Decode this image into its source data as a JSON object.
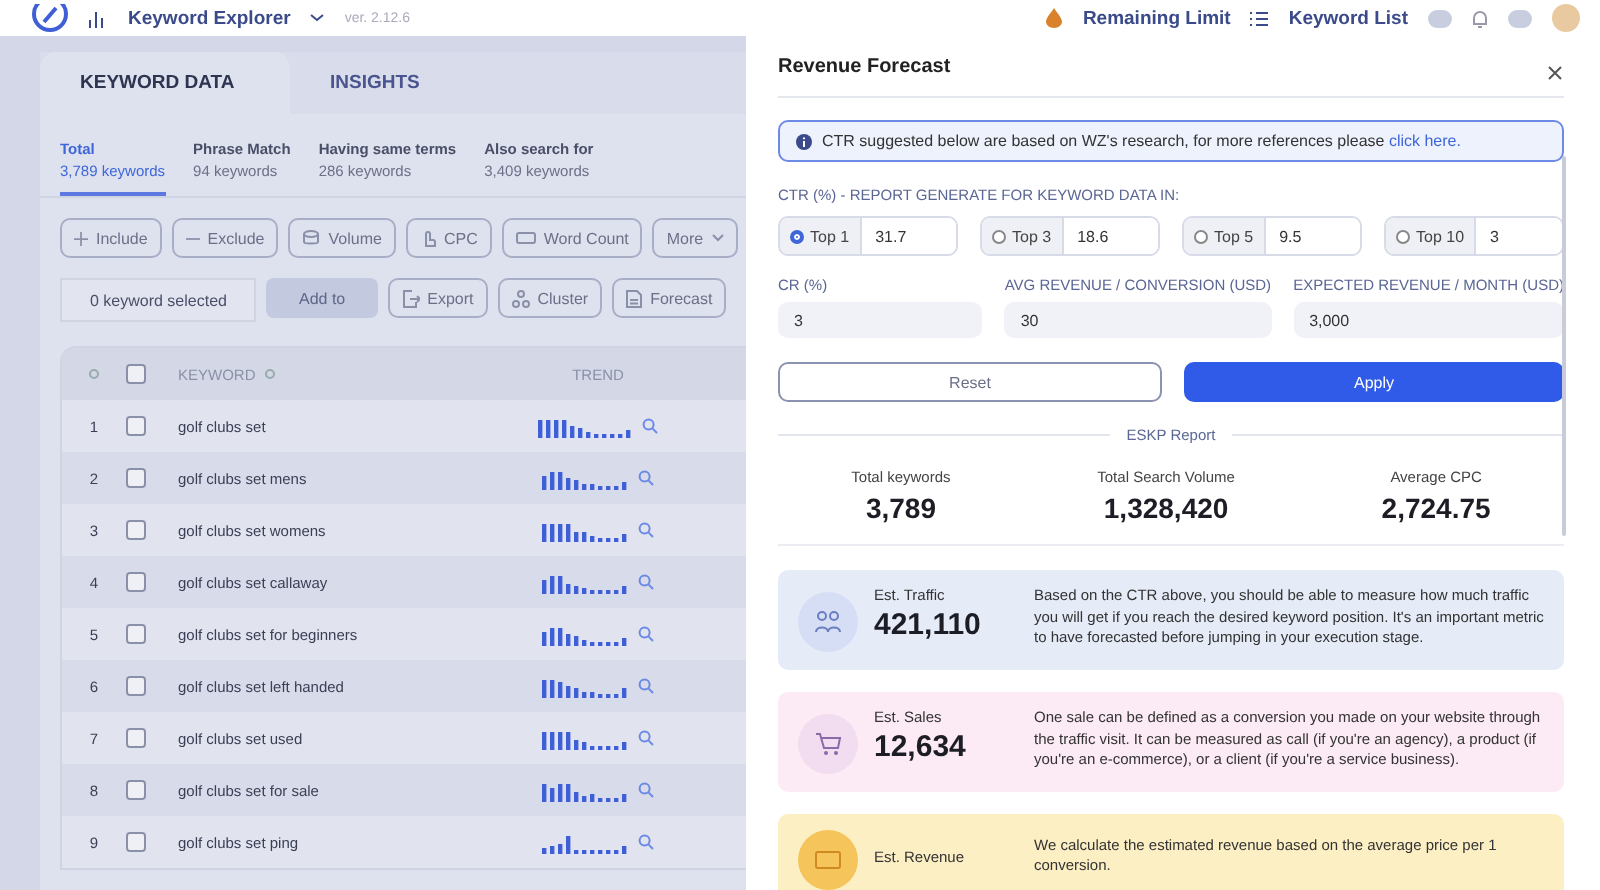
{
  "top_bar": {
    "app_title": "Keyword Explorer",
    "version": "ver. 2.12.6",
    "remaining_limit": "Remaining Limit",
    "keyword_list": "Keyword List"
  },
  "main_tabs": [
    {
      "label": "KEYWORD DATA",
      "selected": true
    },
    {
      "label": "INSIGHTS",
      "selected": false
    }
  ],
  "sub_tabs": [
    {
      "label": "Total",
      "count": "3,789 keywords",
      "selected": true
    },
    {
      "label": "Phrase Match",
      "count": "94 keywords",
      "selected": false
    },
    {
      "label": "Having same terms",
      "count": "286 keywords",
      "selected": false
    },
    {
      "label": "Also search for",
      "count": "3,409 keywords",
      "selected": false
    }
  ],
  "filters": [
    {
      "label": "Include",
      "kind": "plus"
    },
    {
      "label": "Exclude",
      "kind": "minus"
    },
    {
      "label": "Volume",
      "kind": "volume"
    },
    {
      "label": "CPC",
      "kind": "cpc"
    },
    {
      "label": "Word Count",
      "kind": "words"
    },
    {
      "label": "More",
      "kind": "more"
    }
  ],
  "selection": {
    "count": "0 keyword selected",
    "add_button": "Add to",
    "disabled": true
  },
  "actions": [
    {
      "label": "Export",
      "kind": "export"
    },
    {
      "label": "Cluster",
      "kind": "cluster"
    },
    {
      "label": "Forecast",
      "kind": "forecast"
    }
  ],
  "table": {
    "columns": [
      "KEYWORD",
      "TREND"
    ],
    "all_checked": false,
    "rows": [
      {
        "index": "1",
        "keyword": "golf clubs set",
        "checked": false
      },
      {
        "index": "2",
        "keyword": "golf clubs set mens",
        "checked": false
      },
      {
        "index": "3",
        "keyword": "golf clubs set womens",
        "checked": false
      },
      {
        "index": "4",
        "keyword": "golf clubs set callaway",
        "checked": false
      },
      {
        "index": "5",
        "keyword": "golf clubs set for beginners",
        "checked": false
      },
      {
        "index": "6",
        "keyword": "golf clubs set left handed",
        "checked": false
      },
      {
        "index": "7",
        "keyword": "golf clubs set used",
        "checked": false
      },
      {
        "index": "8",
        "keyword": "golf clubs set for sale",
        "checked": false
      },
      {
        "index": "9",
        "keyword": "golf clubs set ping",
        "checked": false
      }
    ]
  },
  "drawer": {
    "title": "Revenue Forecast",
    "notice": {
      "text": "CTR suggested below are based on WZ's research, for more references please",
      "link": "click here."
    },
    "ctr_label": "CTR (%) - REPORT GENERATE FOR KEYWORD DATA IN:",
    "ctr_options": [
      {
        "label": "Top 1",
        "value": "31.7",
        "selected": true
      },
      {
        "label": "Top 3",
        "value": "18.6",
        "selected": false
      },
      {
        "label": "Top 5",
        "value": "9.5",
        "selected": false
      },
      {
        "label": "Top 10",
        "value": "3",
        "selected": false
      }
    ],
    "fields": [
      {
        "label": "CR (%)",
        "value": "3"
      },
      {
        "label": "AVG REVENUE / CONVERSION (USD)",
        "value": "30"
      },
      {
        "label": "EXPECTED REVENUE / MONTH (USD)",
        "value": "3,000"
      }
    ],
    "reset": "Reset",
    "apply": "Apply",
    "report_title": "ESKP Report",
    "stats": [
      {
        "label": "Total keywords",
        "value": "3,789"
      },
      {
        "label": "Total Search Volume",
        "value": "1,328,420"
      },
      {
        "label": "Average CPC",
        "value": "2,724.75"
      }
    ],
    "estimates": [
      {
        "kind": "traffic",
        "label": "Est. Traffic",
        "value": "421,110",
        "description": "Based on the CTR above, you should be able to measure how much traffic you will get if you reach the desired keyword position. It's an important metric to have forecasted before jumping in your execution stage."
      },
      {
        "kind": "sales",
        "label": "Est. Sales",
        "value": "12,634",
        "description": "One sale can be defined as a conversion you made on your website through the traffic visit. It can be measured as call (if you're an agency), a product (if you're an e-commerce), or a client (if you're a service business)."
      },
      {
        "kind": "revenue",
        "label": "Est. Revenue",
        "description": "We calculate the estimated revenue based on the average price per 1 conversion."
      }
    ]
  }
}
